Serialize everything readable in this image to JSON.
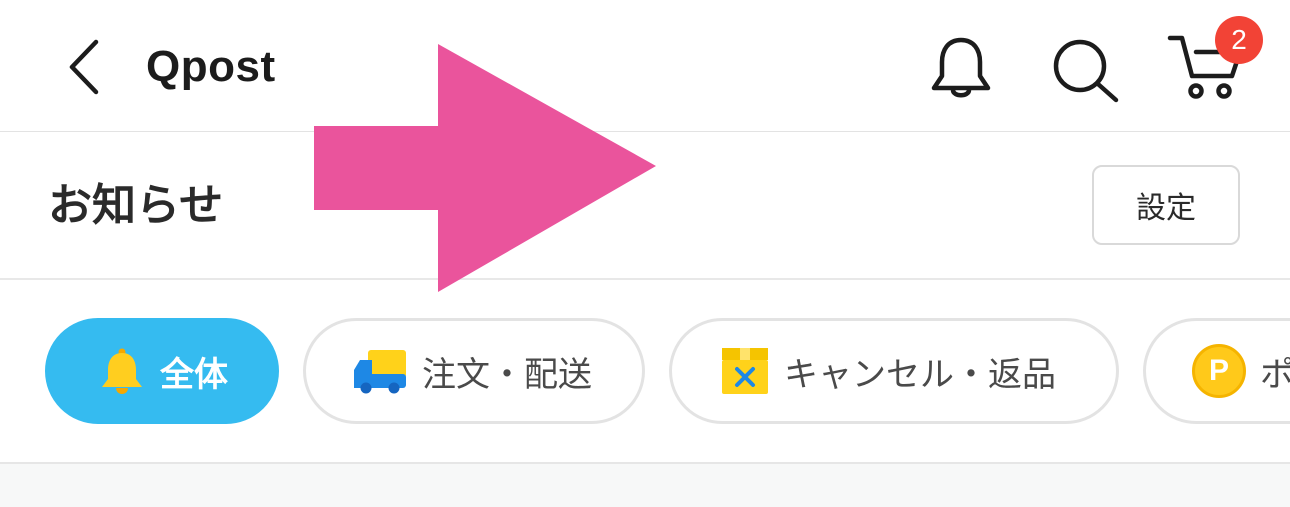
{
  "header": {
    "title": "Qpost",
    "cart_badge": "2",
    "icons": [
      "back-icon",
      "bell-icon",
      "search-icon",
      "cart-icon"
    ]
  },
  "section": {
    "title": "お知らせ",
    "settings_label": "設定"
  },
  "filters": [
    {
      "label": "全体",
      "icon": "bell-icon",
      "active": true
    },
    {
      "label": "注文・配送",
      "icon": "truck-icon",
      "active": false
    },
    {
      "label": "キャンセル・返品",
      "icon": "box-cancel-icon",
      "active": false
    },
    {
      "label": "ポ",
      "icon": "point-coin-icon",
      "icon_text": "P",
      "active": false
    }
  ],
  "colors": {
    "accent": "#35bbf0",
    "badge": "#f24336",
    "annotation_arrow": "#ea549c",
    "coin": "#ffc91a",
    "truck": "#1e88e5"
  }
}
